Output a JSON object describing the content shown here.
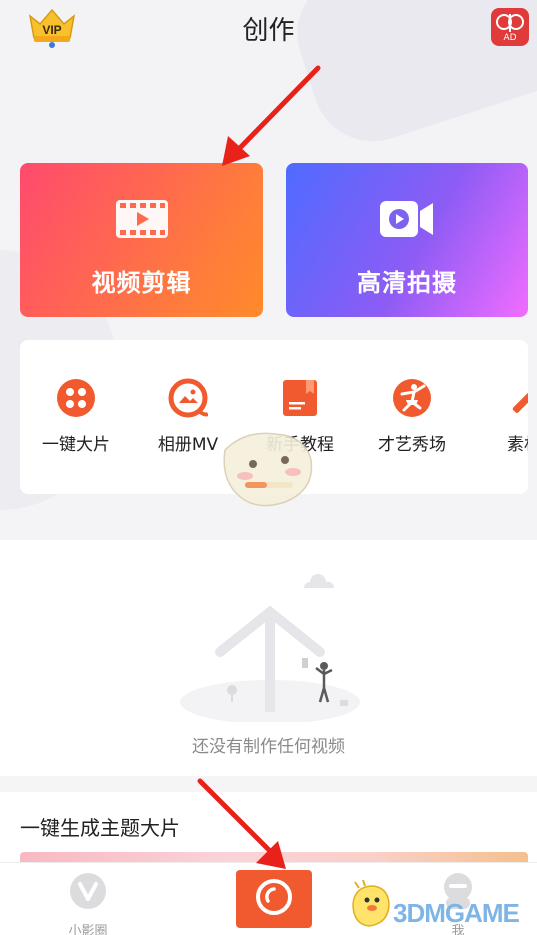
{
  "header": {
    "title": "创作",
    "vip_label": "VIP",
    "ad_label": "AD"
  },
  "cards": [
    {
      "label": "视频剪辑",
      "icon": "film-play-icon"
    },
    {
      "label": "高清拍摄",
      "icon": "video-camera-icon"
    }
  ],
  "tools": [
    {
      "label": "一键大片",
      "icon": "film-reel-icon"
    },
    {
      "label": "相册MV",
      "icon": "photo-album-icon"
    },
    {
      "label": "新手教程",
      "icon": "tutorial-book-icon"
    },
    {
      "label": "才艺秀场",
      "icon": "dancer-icon"
    },
    {
      "label": "素材",
      "icon": "magic-wand-icon"
    }
  ],
  "empty_state": {
    "text": "还没有制作任何视频"
  },
  "themed": {
    "title": "一键生成主题大片"
  },
  "tabbar": {
    "items": [
      {
        "label": "小影圈",
        "icon": "v-circle-icon"
      },
      {
        "label": "",
        "icon": "camera-shutter-icon"
      },
      {
        "label": "我",
        "icon": "profile-icon"
      }
    ]
  },
  "watermark": {
    "text": "3DMGAME"
  },
  "colors": {
    "accent_orange": "#f05a2e",
    "arrow_red": "#e8221a",
    "edit_gradient_start": "#ff4a6e",
    "edit_gradient_end": "#ff8a2a",
    "shoot_gradient_start": "#4f6bff",
    "shoot_gradient_end": "#f16dff"
  }
}
